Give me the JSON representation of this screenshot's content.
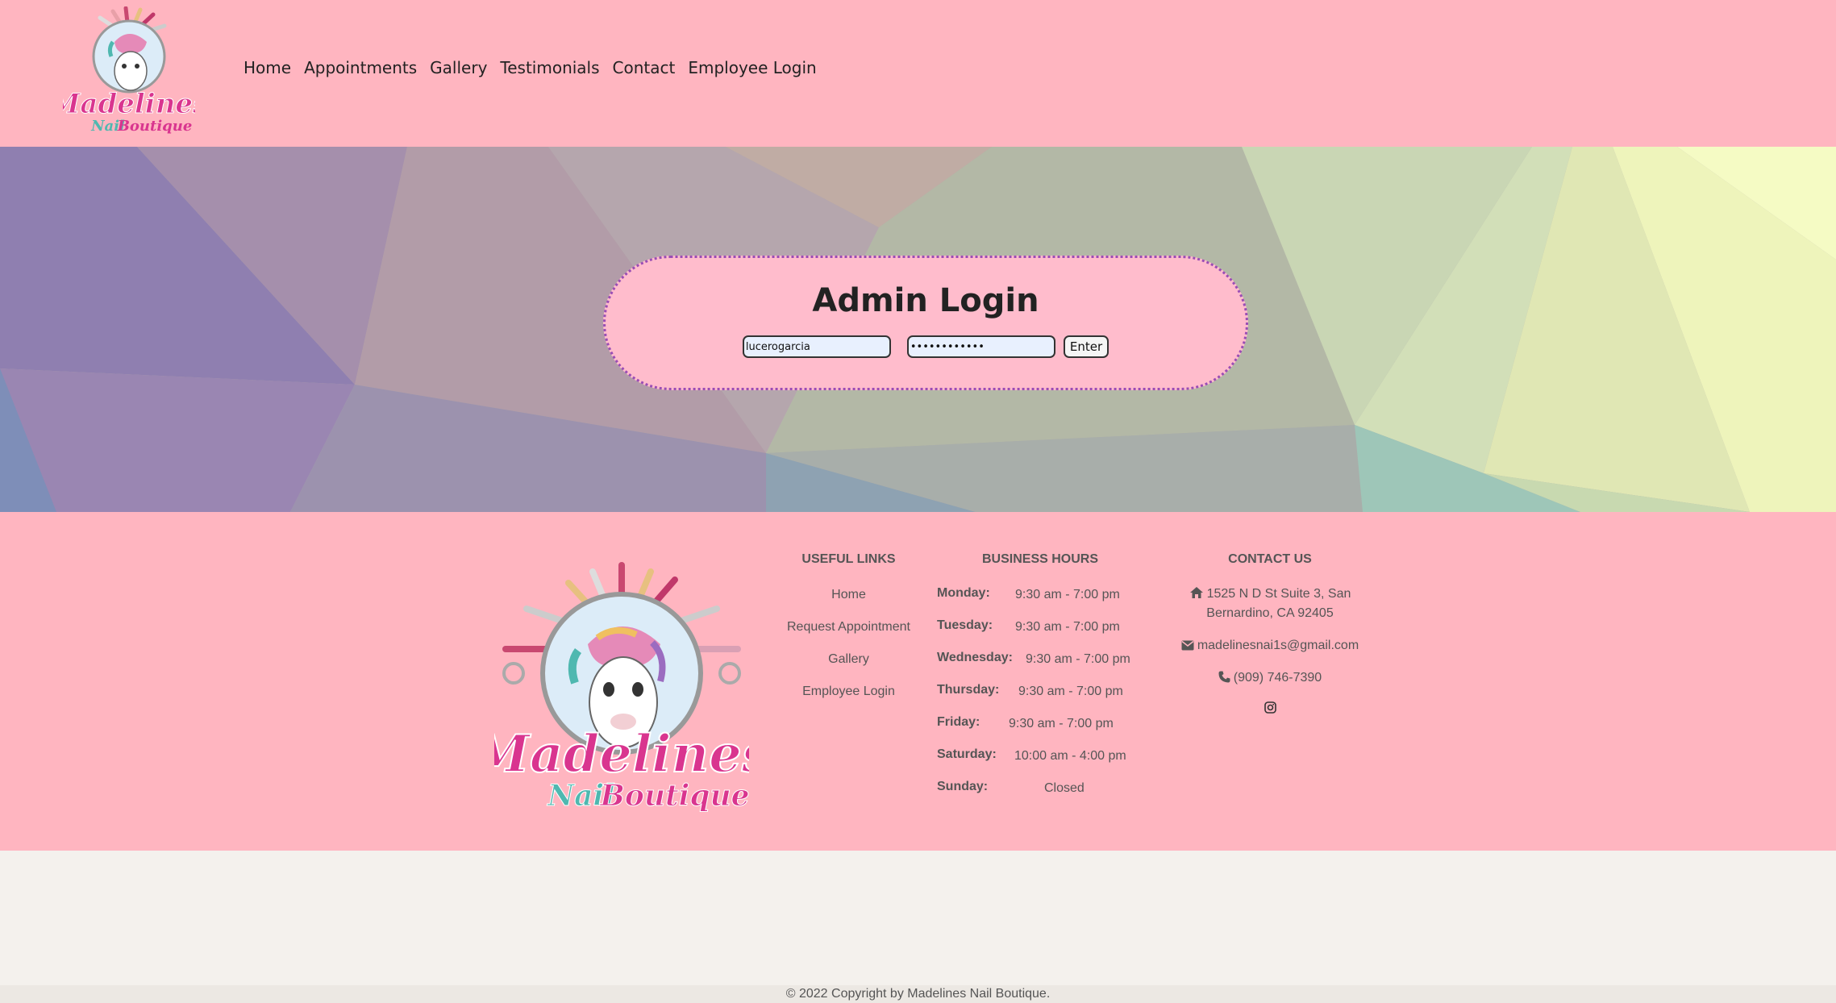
{
  "header": {
    "logo_alt": "Madelines Nail Boutique",
    "nav": [
      {
        "label": "Home"
      },
      {
        "label": "Appointments"
      },
      {
        "label": "Gallery"
      },
      {
        "label": "Testimonials"
      },
      {
        "label": "Contact"
      },
      {
        "label": "Employee Login"
      }
    ]
  },
  "login": {
    "title": "Admin Login",
    "username_value": "lucerogarcia",
    "password_value": "••••••••••••",
    "submit_label": "Enter"
  },
  "footer": {
    "logo": {
      "line1": "Madelines",
      "line2a": "Nail",
      "line2b": "Boutique"
    },
    "useful_links": {
      "title": "USEFUL LINKS",
      "items": [
        "Home",
        "Request Appointment",
        "Gallery",
        "Employee Login"
      ]
    },
    "hours": {
      "title": "BUSINESS HOURS",
      "rows": [
        {
          "day": "Monday:",
          "time": "9:30 am - 7:00 pm"
        },
        {
          "day": "Tuesday:",
          "time": "9:30 am - 7:00 pm"
        },
        {
          "day": "Wednesday:",
          "time": "9:30 am - 7:00 pm"
        },
        {
          "day": "Thursday:",
          "time": "9:30 am - 7:00 pm"
        },
        {
          "day": "Friday:",
          "time": "9:30 am - 7:00 pm"
        },
        {
          "day": "Saturday:",
          "time": "10:00 am - 4:00 pm"
        },
        {
          "day": "Sunday:",
          "time": "Closed"
        }
      ]
    },
    "contact": {
      "title": "CONTACT US",
      "address_line1": "1525 N D St Suite 3, San",
      "address_line2": "Bernardino, CA 92405",
      "email": "madelinesnai1s@gmail.com",
      "phone": "(909) 746-7390",
      "social_icon": "instagram-icon"
    }
  },
  "copyright": "© 2022 Copyright by Madelines Nail Boutique.",
  "colors": {
    "header_bg": "#ffb5c0",
    "login_bg": "#ffbccc",
    "login_border": "#9a4db5",
    "logo_pink": "#d9358f",
    "logo_teal": "#4fb8b0"
  }
}
